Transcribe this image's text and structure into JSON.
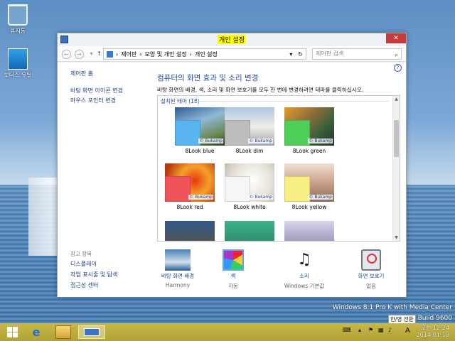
{
  "desktop": {
    "icons": [
      {
        "label": "휴지통"
      },
      {
        "label": "보너스 유틸"
      }
    ],
    "watermark_line1": "Windows 8.1 Pro K with Media Center",
    "watermark_line2": "Build 9600"
  },
  "window": {
    "title": "개인 설정",
    "close_label": "✕"
  },
  "toolbar": {
    "back": "←",
    "forward": "→",
    "recent": "▾",
    "up": "↑",
    "breadcrumb": [
      "제어판",
      "모양 및 개인 설정",
      "개인 설정"
    ],
    "breadcrumb_sep": "›",
    "dropdown": "▾",
    "refresh": "↻",
    "search_placeholder": "제어판 검색",
    "search_icon": "⌕"
  },
  "left_pane": {
    "home": "제어판 홈",
    "links": [
      "바탕 화면 아이콘 변경",
      "마우스 포인터 변경"
    ],
    "see_also_title": "참고 항목",
    "see_also": [
      "디스플레이",
      "작업 표시줄 및 탐색",
      "접근성 센터"
    ]
  },
  "content": {
    "help": "?",
    "heading": "컴퓨터의 화면 효과 및 소리 변경",
    "description": "바탕 화면의 배경, 색, 소리 및 화면 보호기를 모두 한 번에 변경하려면 테마를 클릭하십시오.",
    "group_label": "설치된 테마 (18)",
    "logo_text": "© Bukamp",
    "themes": [
      {
        "label": "8Look blue",
        "color": "#5ab4ef"
      },
      {
        "label": "8Look dim",
        "color": "#bdbdbd"
      },
      {
        "label": "8Look green",
        "color": "#4fcf5a"
      },
      {
        "label": "8Look red",
        "color": "#f0535a"
      },
      {
        "label": "8Look white",
        "color": "#f6f6f6"
      },
      {
        "label": "8Look yellow",
        "color": "#f8ef84"
      }
    ]
  },
  "bottom": [
    {
      "name": "바탕 화면 배경",
      "value": "Harmony"
    },
    {
      "name": "색",
      "value": "자동"
    },
    {
      "name": "소리",
      "value": "Windows 기본값"
    },
    {
      "name": "화면 보호기",
      "value": "없음"
    }
  ],
  "taskbar": {
    "ime": "한/영 전환",
    "ime_lang": "A",
    "clock_time": "오전 12:24",
    "clock_date": "2014-01-18"
  }
}
